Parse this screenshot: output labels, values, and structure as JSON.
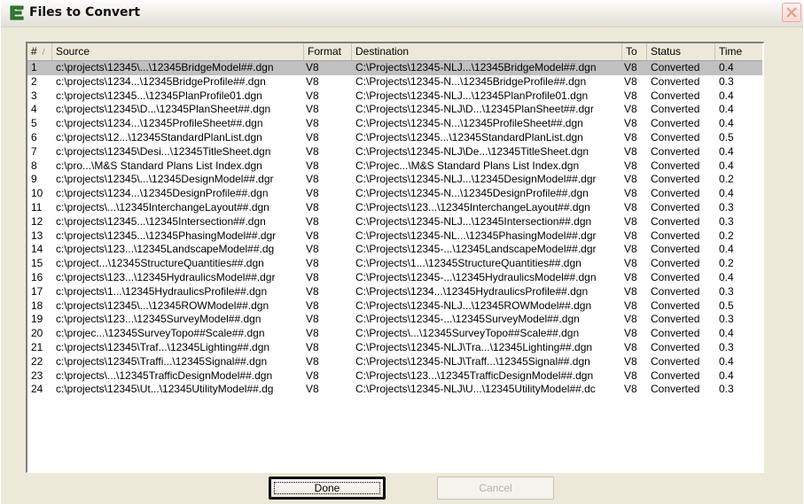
{
  "window": {
    "title": "Files to Convert",
    "close_icon": "close-x-icon",
    "title_icon": "convert-files-icon"
  },
  "table": {
    "columns": {
      "num": "#",
      "source": "Source",
      "format": "Format",
      "destination": "Destination",
      "to": "To",
      "status": "Status",
      "time": "Time"
    },
    "selected_row": 1,
    "rows": [
      {
        "num": "1",
        "source": "c:\\projects\\12345\\...\\12345BridgeModel##.dgn",
        "format": "V8",
        "destination": "C:\\Projects\\12345-NLJ...\\12345BridgeModel##.dgn",
        "to": "V8",
        "status": "Converted",
        "time": "0.4"
      },
      {
        "num": "2",
        "source": "c:\\projects\\1234...\\12345BridgeProfile##.dgn",
        "format": "V8",
        "destination": "C:\\Projects\\12345-N...\\12345BridgeProfile##.dgn",
        "to": "V8",
        "status": "Converted",
        "time": "0.3"
      },
      {
        "num": "3",
        "source": "c:\\projects\\12345...\\12345PlanProfile01.dgn",
        "format": "V8",
        "destination": "C:\\Projects\\12345-NLJ...\\12345PlanProfile01.dgn",
        "to": "V8",
        "status": "Converted",
        "time": "0.4"
      },
      {
        "num": "4",
        "source": "c:\\projects\\12345\\D...\\12345PlanSheet##.dgn",
        "format": "V8",
        "destination": "C:\\Projects\\12345-NLJ\\D...\\12345PlanSheet##.dgr",
        "to": "V8",
        "status": "Converted",
        "time": "0.4"
      },
      {
        "num": "5",
        "source": "c:\\projects\\1234...\\12345ProfileSheet##.dgn",
        "format": "V8",
        "destination": "C:\\Projects\\12345-N...\\12345ProfileSheet##.dgn",
        "to": "V8",
        "status": "Converted",
        "time": "0.4"
      },
      {
        "num": "6",
        "source": "c:\\projects\\12...\\12345StandardPlanList.dgn",
        "format": "V8",
        "destination": "C:\\Projects\\12345...\\12345StandardPlanList.dgn",
        "to": "V8",
        "status": "Converted",
        "time": "0.5"
      },
      {
        "num": "7",
        "source": "c:\\projects\\12345\\Desi...\\12345TitleSheet.dgn",
        "format": "V8",
        "destination": "C:\\Projects\\12345-NLJ\\De...\\12345TitleSheet.dgn",
        "to": "V8",
        "status": "Converted",
        "time": "0.4"
      },
      {
        "num": "8",
        "source": "c:\\pro...\\M&S Standard Plans List Index.dgn",
        "format": "V8",
        "destination": "C:\\Projec...\\M&S Standard Plans List Index.dgn",
        "to": "V8",
        "status": "Converted",
        "time": "0.4"
      },
      {
        "num": "9",
        "source": "c:\\projects\\12345\\...\\12345DesignModel##.dgr",
        "format": "V8",
        "destination": "C:\\Projects\\12345-NLJ...\\12345DesignModel##.dgr",
        "to": "V8",
        "status": "Converted",
        "time": "0.2"
      },
      {
        "num": "10",
        "source": "c:\\projects\\1234...\\12345DesignProfile##.dgn",
        "format": "V8",
        "destination": "C:\\Projects\\12345-N...\\12345DesignProfile##.dgn",
        "to": "V8",
        "status": "Converted",
        "time": "0.4"
      },
      {
        "num": "11",
        "source": "c:\\projects\\...\\12345InterchangeLayout##.dgn",
        "format": "V8",
        "destination": "C:\\Projects\\123...\\12345InterchangeLayout##.dgn",
        "to": "V8",
        "status": "Converted",
        "time": "0.3"
      },
      {
        "num": "12",
        "source": "c:\\projects\\12345...\\12345Intersection##.dgn",
        "format": "V8",
        "destination": "C:\\Projects\\12345-NLJ...\\12345Intersection##.dgn",
        "to": "V8",
        "status": "Converted",
        "time": "0.3"
      },
      {
        "num": "13",
        "source": "c:\\projects\\12345...\\12345PhasingModel##.dgr",
        "format": "V8",
        "destination": "C:\\Projects\\12345-NL...\\12345PhasingModel##.dgr",
        "to": "V8",
        "status": "Converted",
        "time": "0.2"
      },
      {
        "num": "14",
        "source": "c:\\projects\\123...\\12345LandscapeModel##.dg",
        "format": "V8",
        "destination": "C:\\Projects\\12345-...\\12345LandscapeModel##.dgr",
        "to": "V8",
        "status": "Converted",
        "time": "0.4"
      },
      {
        "num": "15",
        "source": "c:\\project...\\12345StructureQuantities##.dgn",
        "format": "V8",
        "destination": "C:\\Projects\\1...\\12345StructureQuantities##.dgn",
        "to": "V8",
        "status": "Converted",
        "time": "0.2"
      },
      {
        "num": "16",
        "source": "c:\\projects\\123...\\12345HydraulicsModel##.dgr",
        "format": "V8",
        "destination": "C:\\Projects\\12345-...\\12345HydraulicsModel##.dgn",
        "to": "V8",
        "status": "Converted",
        "time": "0.4"
      },
      {
        "num": "17",
        "source": "c:\\projects\\1...\\12345HydraulicsProfile##.dgn",
        "format": "V8",
        "destination": "C:\\Projects\\1234...\\12345HydraulicsProfile##.dgn",
        "to": "V8",
        "status": "Converted",
        "time": "0.3"
      },
      {
        "num": "18",
        "source": "c:\\projects\\12345\\...\\12345ROWModel##.dgn",
        "format": "V8",
        "destination": "C:\\Projects\\12345-NLJ...\\12345ROWModel##.dgn",
        "to": "V8",
        "status": "Converted",
        "time": "0.5"
      },
      {
        "num": "19",
        "source": "c:\\projects\\123...\\12345SurveyModel##.dgn",
        "format": "V8",
        "destination": "C:\\Projects\\12345-...\\12345SurveyModel##.dgn",
        "to": "V8",
        "status": "Converted",
        "time": "0.3"
      },
      {
        "num": "20",
        "source": "c:\\projec...\\12345SurveyTopo##Scale##.dgn",
        "format": "V8",
        "destination": "C:\\Projects\\...\\12345SurveyTopo##Scale##.dgn",
        "to": "V8",
        "status": "Converted",
        "time": "0.4"
      },
      {
        "num": "21",
        "source": "c:\\projects\\12345\\Traf...\\12345Lighting##.dgn",
        "format": "V8",
        "destination": "C:\\Projects\\12345-NLJ\\Tra...\\12345Lighting##.dgn",
        "to": "V8",
        "status": "Converted",
        "time": "0.3"
      },
      {
        "num": "22",
        "source": "c:\\projects\\12345\\Traffi...\\12345Signal##.dgn",
        "format": "V8",
        "destination": "C:\\Projects\\12345-NLJ\\Traff...\\12345Signal##.dgn",
        "to": "V8",
        "status": "Converted",
        "time": "0.4"
      },
      {
        "num": "23",
        "source": "c:\\projects\\...\\12345TrafficDesignModel##.dgn",
        "format": "V8",
        "destination": "C:\\Projects\\123...\\12345TrafficDesignModel##.dgn",
        "to": "V8",
        "status": "Converted",
        "time": "0.4"
      },
      {
        "num": "24",
        "source": "c:\\projects\\12345\\Ut...\\12345UtilityModel##.dg",
        "format": "V8",
        "destination": "C:\\Projects\\12345-NLJ\\U...\\12345UtilityModel##.dc",
        "to": "V8",
        "status": "Converted",
        "time": "0.3"
      }
    ]
  },
  "buttons": {
    "done": "Done",
    "cancel": "Cancel"
  }
}
